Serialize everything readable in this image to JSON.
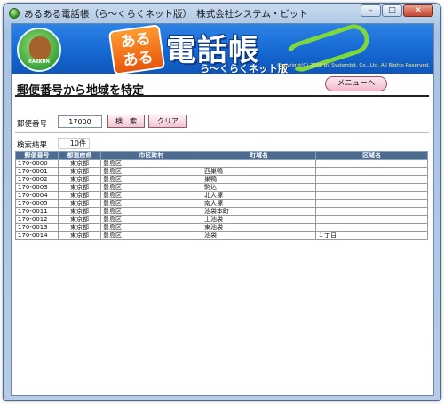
{
  "window": {
    "title": "あるある電話帳（ら〜くらくネット版）　株式会社システム・ビット",
    "controls": {
      "minimize": "–",
      "maximize": "□",
      "close": "✕"
    }
  },
  "banner": {
    "mascot_text": "RAKKUN",
    "logo_badge": "ある\nある",
    "logo_main": "電話帳",
    "logo_sub": "ら〜くらくネット版",
    "copyright": "Copyright(C) 2009 by Systembit, Co., Ltd. All Rights Reserved.",
    "colors": {
      "banner_blue": "#1466d0",
      "accent_orange": "#ff9a2e",
      "accent_green": "#7ed83c"
    }
  },
  "page": {
    "title": "郵便番号から地域を特定",
    "menu_button": "メニューへ"
  },
  "search": {
    "zip_label": "郵便番号",
    "zip_value": "17000",
    "search_button": "検　索",
    "clear_button": "クリア"
  },
  "results": {
    "label": "検索結果",
    "count": "10件",
    "columns": [
      "郵便番号",
      "都道府県",
      "市区町村",
      "町域名",
      "区域名"
    ],
    "rows": [
      [
        "170-0000",
        "東京都",
        "豊島区",
        "",
        ""
      ],
      [
        "170-0001",
        "東京都",
        "豊島区",
        "西巣鴨",
        ""
      ],
      [
        "170-0002",
        "東京都",
        "豊島区",
        "巣鴨",
        ""
      ],
      [
        "170-0003",
        "東京都",
        "豊島区",
        "駒込",
        ""
      ],
      [
        "170-0004",
        "東京都",
        "豊島区",
        "北大塚",
        ""
      ],
      [
        "170-0005",
        "東京都",
        "豊島区",
        "南大塚",
        ""
      ],
      [
        "170-0011",
        "東京都",
        "豊島区",
        "池袋本町",
        ""
      ],
      [
        "170-0012",
        "東京都",
        "豊島区",
        "上池袋",
        ""
      ],
      [
        "170-0013",
        "東京都",
        "豊島区",
        "東池袋",
        ""
      ],
      [
        "170-0014",
        "東京都",
        "豊島区",
        "池袋",
        "１丁目"
      ]
    ]
  }
}
